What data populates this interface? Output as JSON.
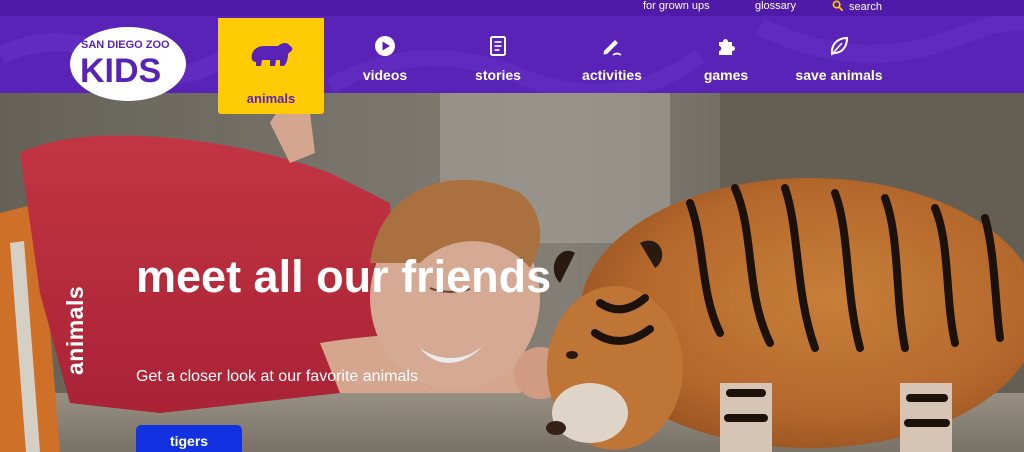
{
  "utility": {
    "for_grown_ups": "for grown ups",
    "glossary": "glossary",
    "search": "search"
  },
  "logo": {
    "line1": "SAN DIEGO ZOO",
    "line2": "KIDS"
  },
  "nav": {
    "animals": "animals",
    "videos": "videos",
    "stories": "stories",
    "activities": "activities",
    "games": "games",
    "save_animals": "save animals"
  },
  "hero": {
    "side_label": "animals",
    "headline": "meet all our friends",
    "subtitle": "Get a closer look at our favorite animals",
    "cta": "tigers"
  },
  "icons": {
    "search": "search-icon",
    "animals": "bear-icon",
    "videos": "play-icon",
    "stories": "book-icon",
    "activities": "pencil-icon",
    "games": "puzzle-icon",
    "save_animals": "leaf-icon"
  },
  "colors": {
    "nav_purple": "#5a23b8",
    "active_yellow": "#ffcb05",
    "cta_blue": "#1231e0",
    "white": "#ffffff"
  }
}
